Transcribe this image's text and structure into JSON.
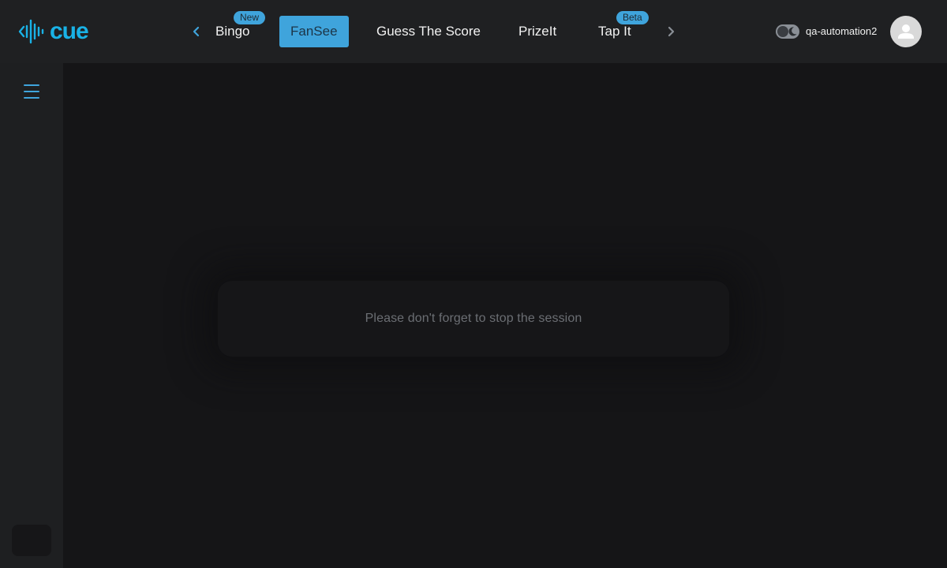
{
  "app": {
    "logo_text": "cue"
  },
  "nav": {
    "tabs": [
      {
        "label": "Bingo",
        "badge": "New",
        "active": false
      },
      {
        "label": "FanSee",
        "badge": "",
        "active": true
      },
      {
        "label": "Guess The Score",
        "badge": "",
        "active": false
      },
      {
        "label": "PrizeIt",
        "badge": "",
        "active": false
      },
      {
        "label": "Tap It",
        "badge": "Beta",
        "active": false
      }
    ],
    "prev_icon": "chevron-left-icon",
    "next_icon": "chevron-right-icon"
  },
  "user": {
    "username": "qa-automation2",
    "theme_toggle_icon": "moon-icon",
    "avatar_icon": "user-icon"
  },
  "sidebar": {
    "menu_icon": "hamburger-menu-icon"
  },
  "main": {
    "message": "Please don't forget to stop the session"
  },
  "colors": {
    "accent": "#3fa4dc",
    "logo": "#19b2e6",
    "topbar_bg": "#1f2022",
    "page_bg": "#151517",
    "sidebar_bg": "#1e1f21"
  }
}
